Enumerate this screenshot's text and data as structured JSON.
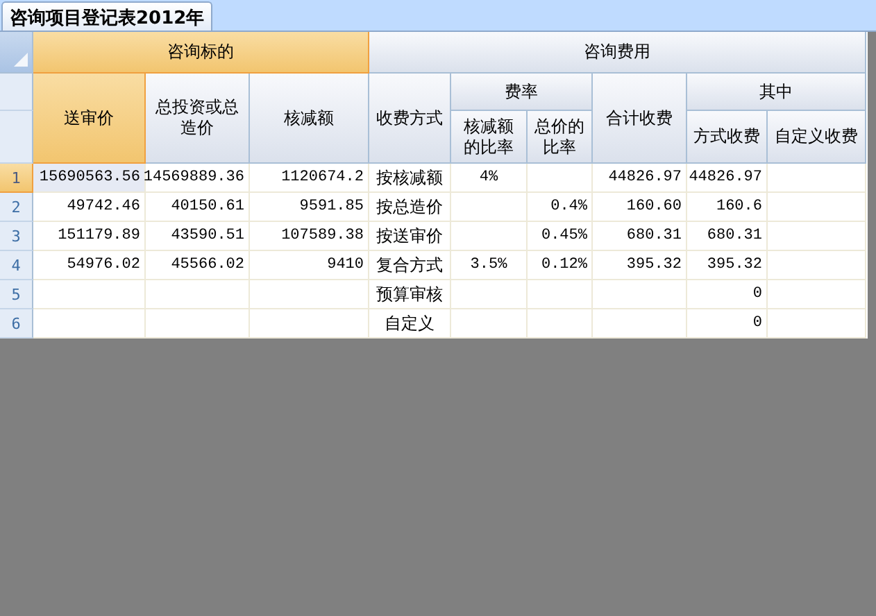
{
  "tabs": [
    {
      "label": "咨询项目登记表2012年",
      "selected": true
    }
  ],
  "header_groups": [
    {
      "label": "咨询标的",
      "selected": true,
      "columns": [
        {
          "label": "送审价",
          "selected": true
        },
        {
          "label": "总投资或总造价",
          "selected": false
        },
        {
          "label": "核减额",
          "selected": false
        }
      ]
    },
    {
      "label": "咨询费用",
      "selected": false,
      "columns": [
        {
          "label": "收费方式",
          "selected": false
        },
        {
          "label": "费率",
          "selected": false,
          "children": [
            {
              "label": "核减额的比率",
              "selected": false
            },
            {
              "label": "总价的比率",
              "selected": false
            }
          ]
        },
        {
          "label": "合计收费",
          "selected": false
        },
        {
          "label": "其中",
          "selected": false,
          "children": [
            {
              "label": "方式收费",
              "selected": false
            },
            {
              "label": "自定义收费",
              "selected": false
            }
          ]
        }
      ]
    }
  ],
  "rows": [
    {
      "number": "1",
      "selected": true,
      "cells": [
        "15690563.56",
        "14569889.36",
        "1120674.2",
        "按核减额",
        "4%",
        "",
        "44826.97",
        "44826.97",
        ""
      ]
    },
    {
      "number": "2",
      "selected": false,
      "cells": [
        "49742.46",
        "40150.61",
        "9591.85",
        "按总造价",
        "",
        "0.4%",
        "160.60",
        "160.6",
        ""
      ]
    },
    {
      "number": "3",
      "selected": false,
      "cells": [
        "151179.89",
        "43590.51",
        "107589.38",
        "按送审价",
        "",
        "0.45%",
        "680.31",
        "680.31",
        ""
      ]
    },
    {
      "number": "4",
      "selected": false,
      "cells": [
        "54976.02",
        "45566.02",
        "9410",
        "复合方式",
        "3.5%",
        "0.12%",
        "395.32",
        "395.32",
        ""
      ]
    },
    {
      "number": "5",
      "selected": false,
      "cells": [
        "",
        "",
        "",
        "预算审核",
        "",
        "",
        "",
        "0",
        ""
      ]
    },
    {
      "number": "6",
      "selected": false,
      "cells": [
        "",
        "",
        "",
        "自定义",
        "",
        "",
        "",
        "0",
        ""
      ]
    }
  ]
}
